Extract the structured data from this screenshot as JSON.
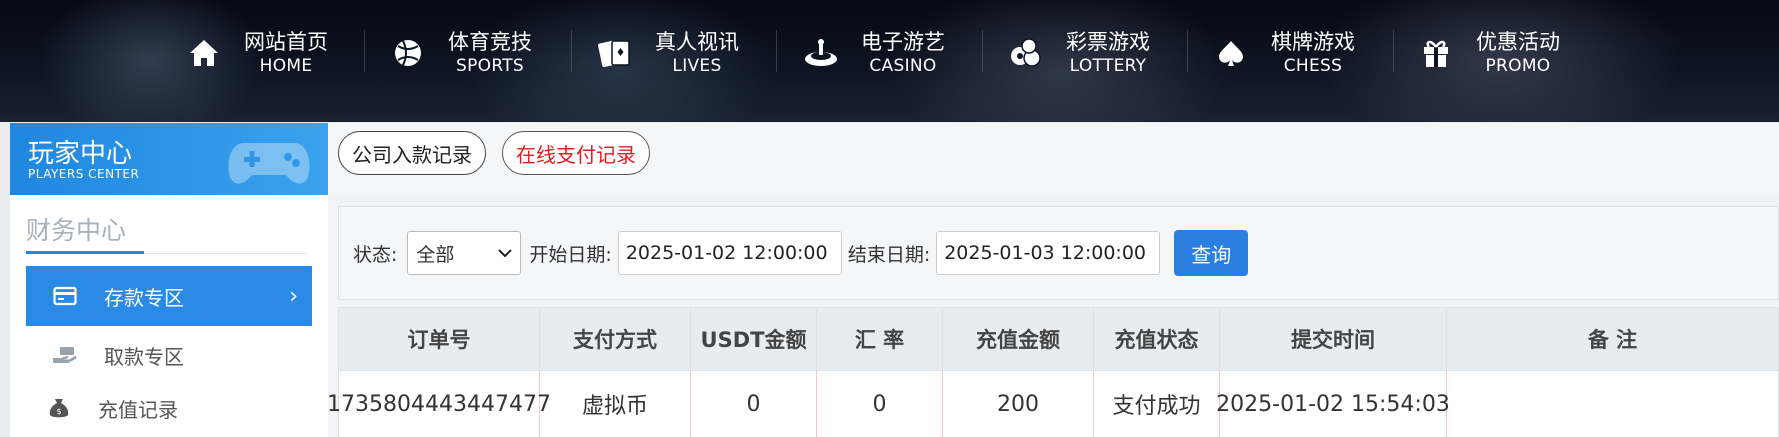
{
  "nav": {
    "items": [
      {
        "zh": "网站首页",
        "en": "HOME",
        "icon": "home-icon"
      },
      {
        "zh": "体育竞技",
        "en": "SPORTS",
        "icon": "ball-icon"
      },
      {
        "zh": "真人视讯",
        "en": "LIVES",
        "icon": "cards-icon"
      },
      {
        "zh": "电子游艺",
        "en": "CASINO",
        "icon": "roulette-icon"
      },
      {
        "zh": "彩票游戏",
        "en": "LOTTERY",
        "icon": "lottery-balls-icon"
      },
      {
        "zh": "棋牌游戏",
        "en": "CHESS",
        "icon": "spade-icon"
      },
      {
        "zh": "优惠活动",
        "en": "PROMO",
        "icon": "gift-icon"
      }
    ]
  },
  "sidebar": {
    "header_title": "玩家中心",
    "header_sub": "PLAYERS CENTER",
    "section_title": "财务中心",
    "items": [
      {
        "label": "存款专区",
        "icon": "card-icon",
        "active": true
      },
      {
        "label": "取款专区",
        "icon": "hand-money-icon",
        "active": false
      },
      {
        "label": "充值记录",
        "icon": "money-bag-icon",
        "active": false
      }
    ]
  },
  "tabs": [
    {
      "label": "公司入款记录"
    },
    {
      "label": "在线支付记录"
    }
  ],
  "filter": {
    "status_label": "状态:",
    "status_value": "全部",
    "start_label": "开始日期:",
    "start_value": "2025-01-02 12:00:00",
    "end_label": "结束日期:",
    "end_value": "2025-01-03 12:00:00",
    "query_label": "查询"
  },
  "table": {
    "headers": [
      "订单号",
      "支付方式",
      "USDT金额",
      "汇 率",
      "充值金额",
      "充值状态",
      "提交时间",
      "备 注"
    ],
    "rows": [
      [
        "1735804443447477",
        "虚拟币",
        "0",
        "0",
        "200",
        "支付成功",
        "2025-01-02 15:54:03",
        ""
      ]
    ]
  },
  "colors": {
    "accent": "#2b8ae6",
    "tab_red": "#e02020",
    "nav_bg": "#0b121e"
  }
}
